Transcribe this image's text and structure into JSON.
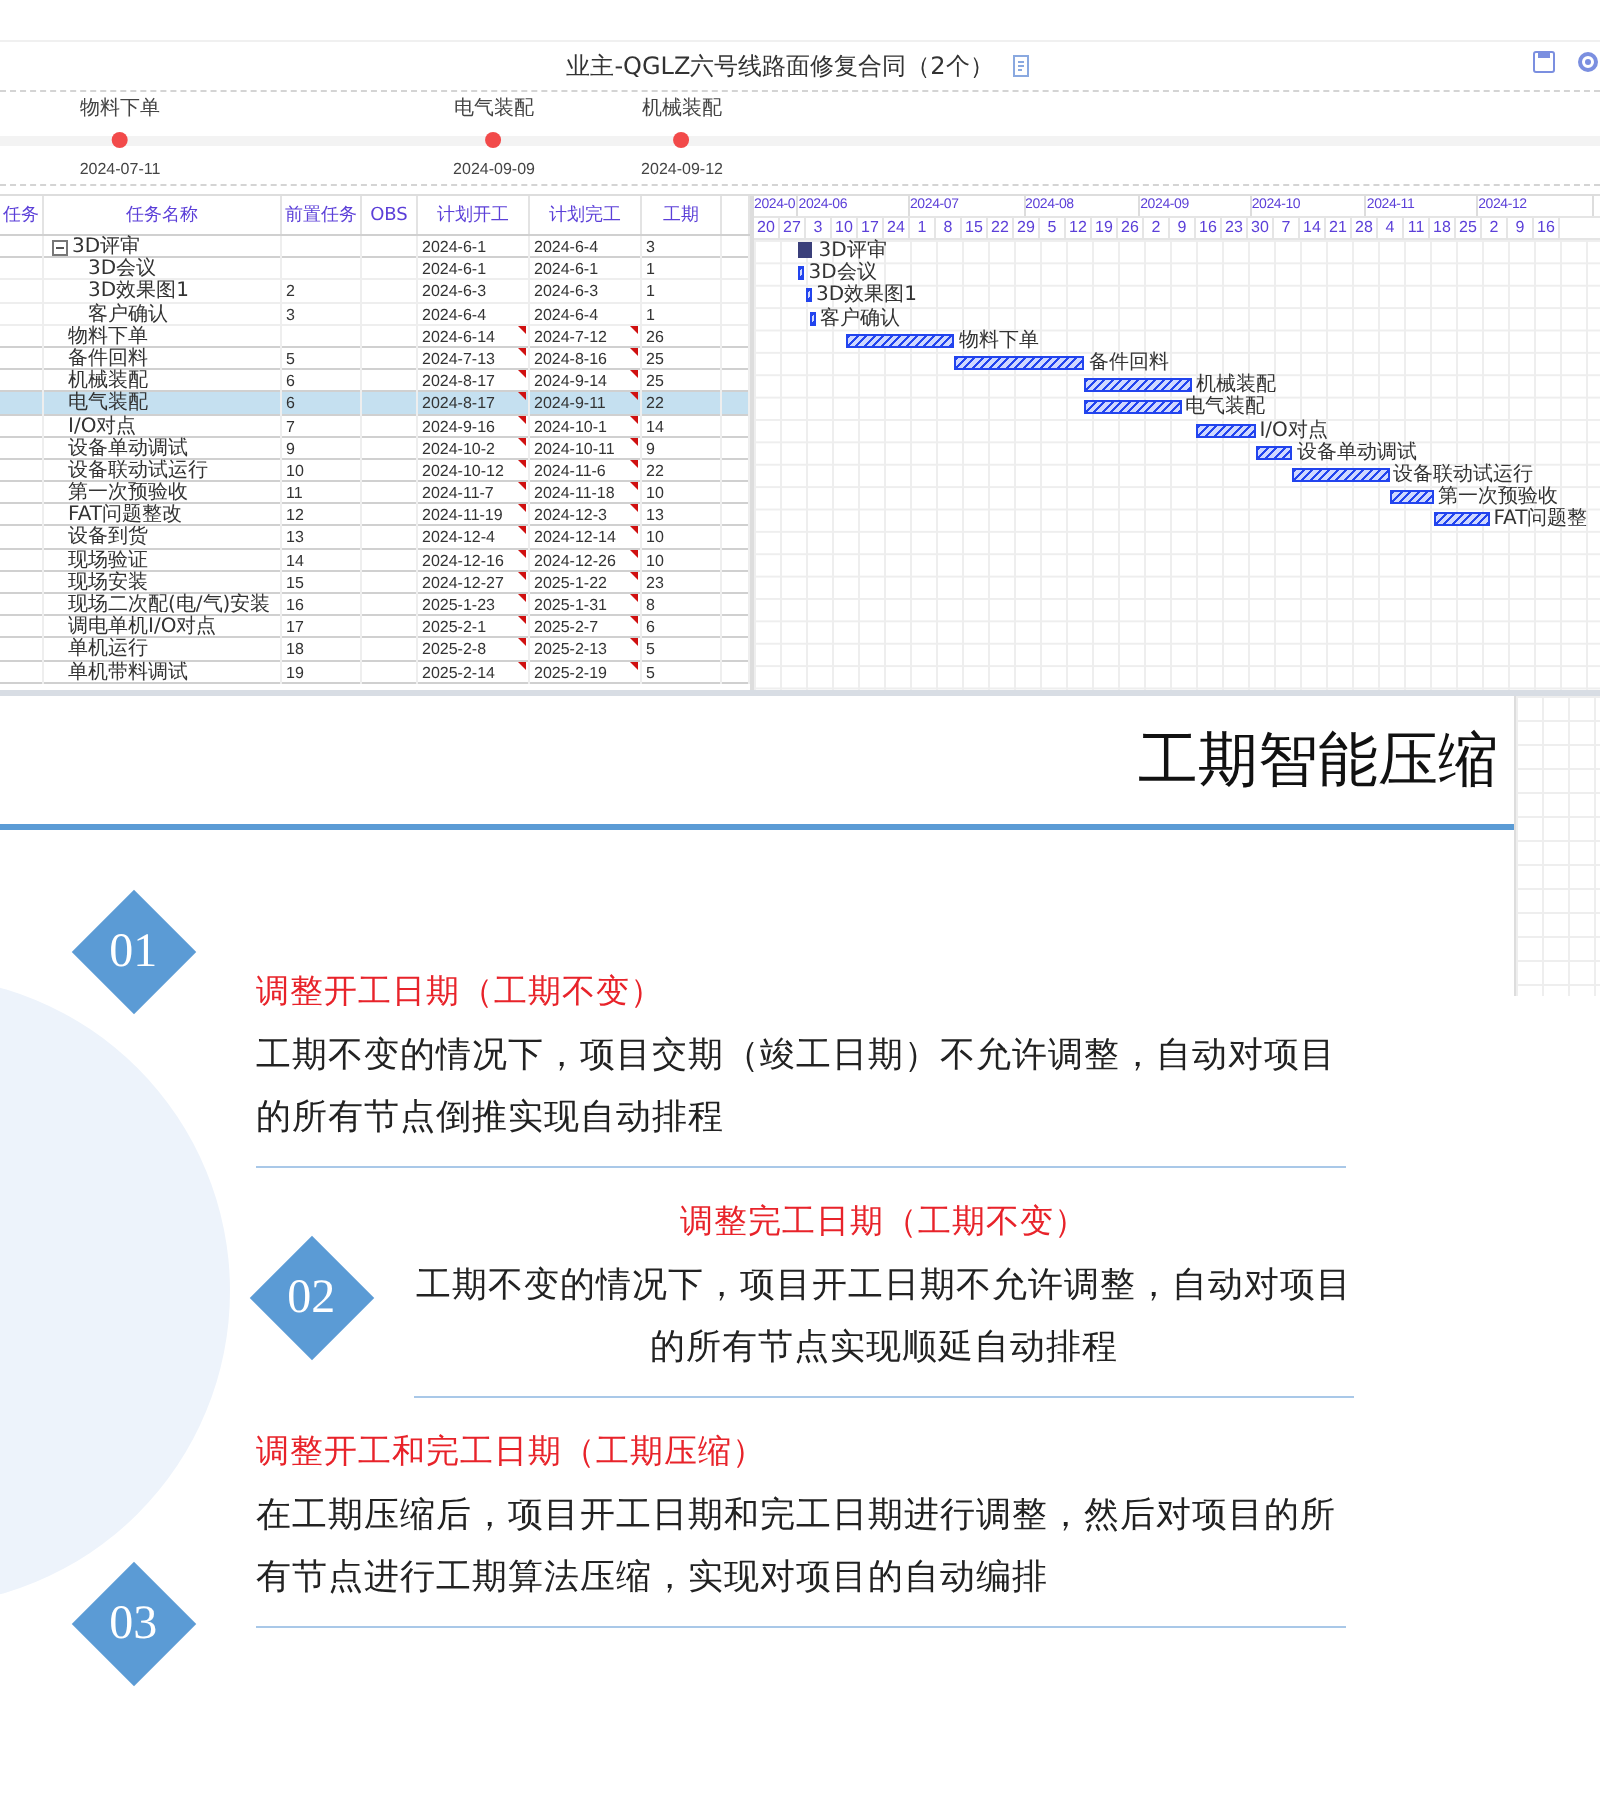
{
  "window": {
    "title": "业主-QGLZ六号线路面修复合同（2个）"
  },
  "milestones": [
    {
      "label": "物料下单",
      "date": "2024-07-11"
    },
    {
      "label": "电气装配",
      "date": "2024-09-09"
    },
    {
      "label": "机械装配",
      "date": "2024-09-12"
    }
  ],
  "table": {
    "columns": [
      "任务",
      "任务名称",
      "前置任务",
      "OBS",
      "计划开工",
      "计划完工",
      "工期"
    ],
    "rows": [
      {
        "name": "3D评审",
        "kind": "group",
        "expanded": true,
        "pred": "",
        "start": "2024-6-1",
        "end": "2024-6-4",
        "duration": "3",
        "flagged": false,
        "selected": false
      },
      {
        "name": "3D会议",
        "kind": "child",
        "pred": "",
        "start": "2024-6-1",
        "end": "2024-6-1",
        "duration": "1",
        "flagged": false,
        "selected": false
      },
      {
        "name": "3D效果图1",
        "kind": "child",
        "pred": "2",
        "start": "2024-6-3",
        "end": "2024-6-3",
        "duration": "1",
        "flagged": false,
        "selected": false
      },
      {
        "name": "客户确认",
        "kind": "child",
        "pred": "3",
        "start": "2024-6-4",
        "end": "2024-6-4",
        "duration": "1",
        "flagged": false,
        "selected": false
      },
      {
        "name": "物料下单",
        "kind": "task",
        "pred": "",
        "start": "2024-6-14",
        "end": "2024-7-12",
        "duration": "26",
        "flagged": true,
        "selected": false
      },
      {
        "name": "备件回料",
        "kind": "task",
        "pred": "5",
        "start": "2024-7-13",
        "end": "2024-8-16",
        "duration": "25",
        "flagged": true,
        "selected": false
      },
      {
        "name": "机械装配",
        "kind": "task",
        "pred": "6",
        "start": "2024-8-17",
        "end": "2024-9-14",
        "duration": "25",
        "flagged": true,
        "selected": false
      },
      {
        "name": "电气装配",
        "kind": "task",
        "pred": "6",
        "start": "2024-8-17",
        "end": "2024-9-11",
        "duration": "22",
        "flagged": true,
        "selected": true
      },
      {
        "name": "I/O对点",
        "kind": "task",
        "pred": "7",
        "start": "2024-9-16",
        "end": "2024-10-1",
        "duration": "14",
        "flagged": true,
        "selected": false
      },
      {
        "name": "设备单动调试",
        "kind": "task",
        "pred": "9",
        "start": "2024-10-2",
        "end": "2024-10-11",
        "duration": "9",
        "flagged": true,
        "selected": false
      },
      {
        "name": "设备联动试运行",
        "kind": "task",
        "pred": "10",
        "start": "2024-10-12",
        "end": "2024-11-6",
        "duration": "22",
        "flagged": true,
        "selected": false
      },
      {
        "name": "第一次预验收",
        "kind": "task",
        "pred": "11",
        "start": "2024-11-7",
        "end": "2024-11-18",
        "duration": "10",
        "flagged": true,
        "selected": false
      },
      {
        "name": "FAT问题整改",
        "kind": "task",
        "pred": "12",
        "start": "2024-11-19",
        "end": "2024-12-3",
        "duration": "13",
        "flagged": true,
        "selected": false
      },
      {
        "name": "设备到货",
        "kind": "task",
        "pred": "13",
        "start": "2024-12-4",
        "end": "2024-12-14",
        "duration": "10",
        "flagged": true,
        "selected": false
      },
      {
        "name": "现场验证",
        "kind": "task",
        "pred": "14",
        "start": "2024-12-16",
        "end": "2024-12-26",
        "duration": "10",
        "flagged": true,
        "selected": false
      },
      {
        "name": "现场安装",
        "kind": "task",
        "pred": "15",
        "start": "2024-12-27",
        "end": "2025-1-22",
        "duration": "23",
        "flagged": true,
        "selected": false
      },
      {
        "name": "现场二次配(电/气)安装",
        "kind": "task",
        "pred": "16",
        "start": "2025-1-23",
        "end": "2025-1-31",
        "duration": "8",
        "flagged": true,
        "selected": false
      },
      {
        "name": "调电单机I/O对点",
        "kind": "task",
        "pred": "17",
        "start": "2025-2-1",
        "end": "2025-2-7",
        "duration": "6",
        "flagged": true,
        "selected": false
      },
      {
        "name": "单机运行",
        "kind": "task",
        "pred": "18",
        "start": "2025-2-8",
        "end": "2025-2-13",
        "duration": "5",
        "flagged": true,
        "selected": false
      },
      {
        "name": "单机带料调试",
        "kind": "task",
        "pred": "19",
        "start": "2025-2-14",
        "end": "2025-2-19",
        "duration": "5",
        "flagged": true,
        "selected": false
      }
    ]
  },
  "gantt": {
    "months": [
      "2024-0",
      "2024-06",
      "2024-07",
      "2024-08",
      "2024-09",
      "2024-10",
      "2024-11",
      "2024-12"
    ],
    "days": [
      "20",
      "27",
      "3",
      "10",
      "17",
      "24",
      "1",
      "8",
      "15",
      "22",
      "29",
      "5",
      "12",
      "19",
      "26",
      "2",
      "9",
      "16",
      "23",
      "30",
      "7",
      "14",
      "21",
      "28",
      "4",
      "11",
      "18",
      "25",
      "2",
      "9",
      "16"
    ],
    "bars": [
      {
        "label": "3D评审",
        "kind": "summary"
      },
      {
        "label": "3D会议",
        "kind": "task"
      },
      {
        "label": "3D效果图1",
        "kind": "task"
      },
      {
        "label": "客户确认",
        "kind": "task"
      },
      {
        "label": "物料下单",
        "kind": "task"
      },
      {
        "label": "备件回料",
        "kind": "task"
      },
      {
        "label": "机械装配",
        "kind": "task"
      },
      {
        "label": "电气装配",
        "kind": "task"
      },
      {
        "label": "I/O对点",
        "kind": "task"
      },
      {
        "label": "设备单动调试",
        "kind": "task"
      },
      {
        "label": "设备联动试运行",
        "kind": "task"
      },
      {
        "label": "第一次预验收",
        "kind": "task"
      },
      {
        "label": "FAT问题整",
        "kind": "task"
      }
    ]
  },
  "slide": {
    "title": "工期智能压缩",
    "items": [
      {
        "number": "01",
        "heading": "调整开工日期（工期不变）",
        "body": "工期不变的情况下，项目交期（竣工日期）不允许调整，自动对项目的所有节点倒推实现自动排程"
      },
      {
        "number": "02",
        "heading": "调整完工日期（工期不变）",
        "body": "工期不变的情况下，项目开工日期不允许调整，自动对项目的所有节点实现顺延自动排程"
      },
      {
        "number": "03",
        "heading": "调整开工和完工日期（工期压缩）",
        "body": "在工期压缩后，项目开工日期和完工日期进行调整，然后对项目的所有节点进行工期算法压缩，实现对项目的自动编排"
      }
    ]
  }
}
